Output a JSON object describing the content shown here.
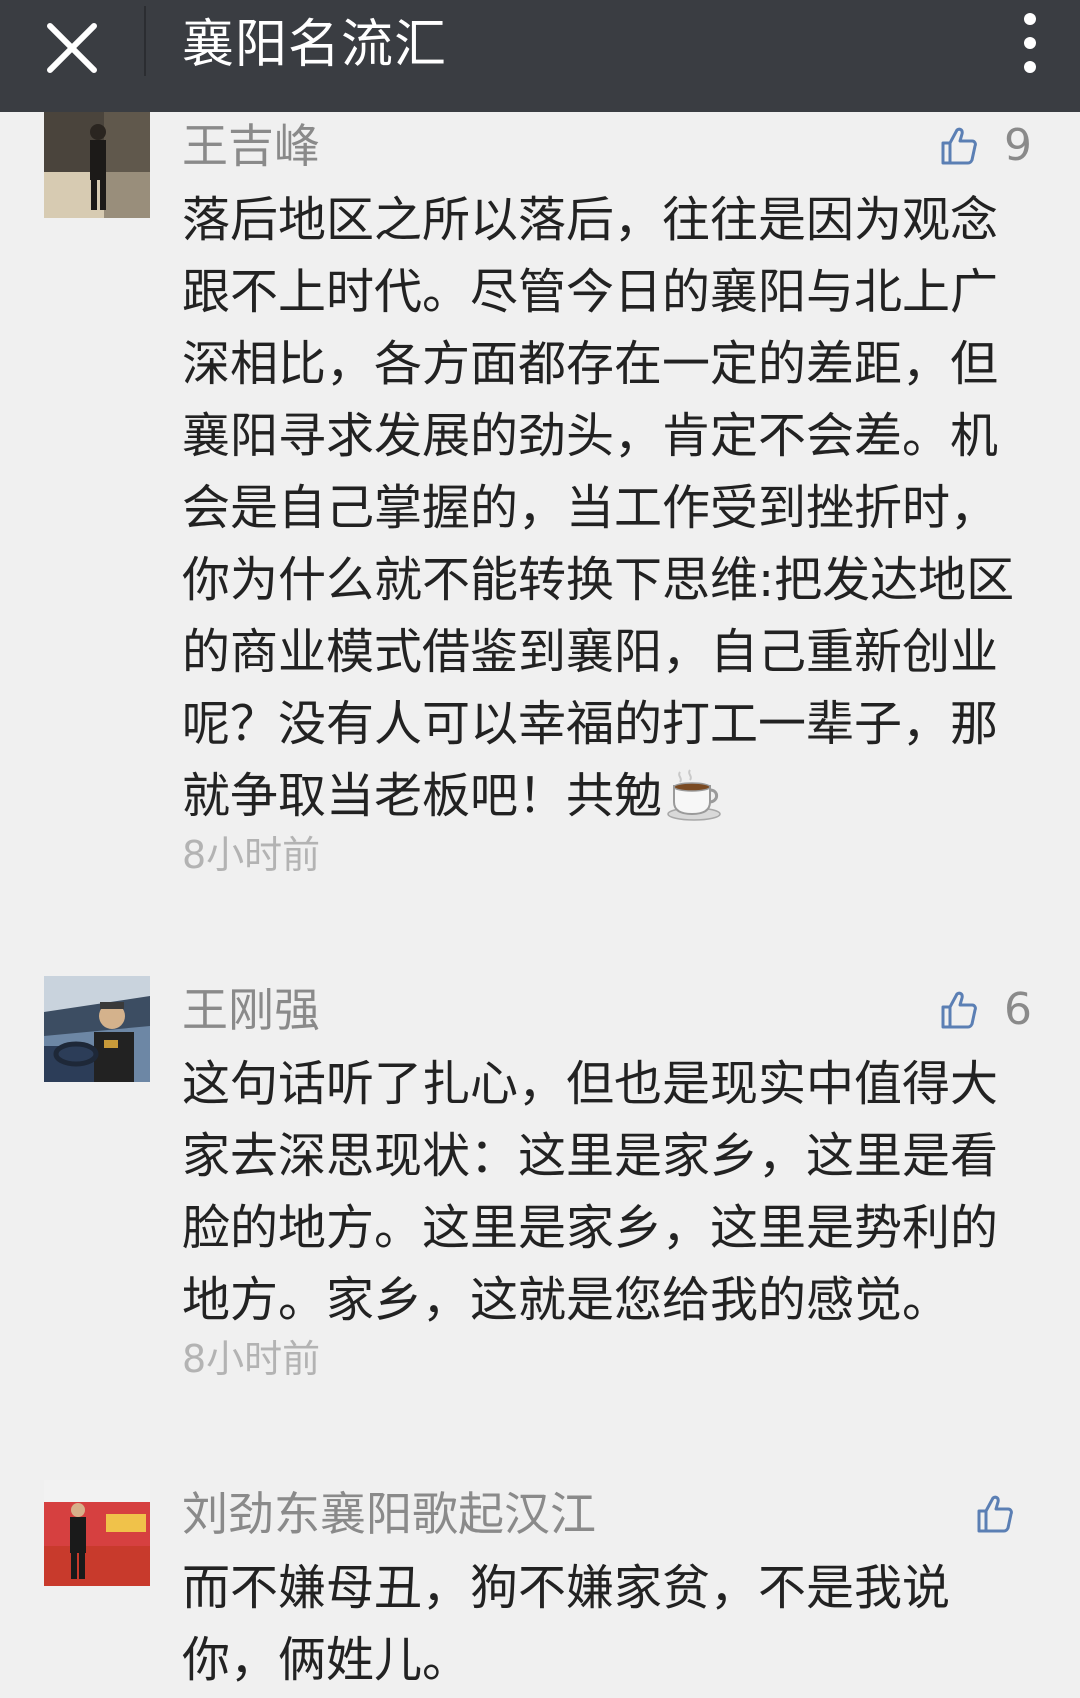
{
  "header": {
    "title": "襄阳名流汇",
    "close_icon": "close-icon",
    "more_icon": "more-vertical-icon",
    "background": "#3a3d42"
  },
  "comments": [
    {
      "name": "王吉峰",
      "likes": "9",
      "text": "落后地区之所以落后，往往是因为观念跟不上时代。尽管今日的襄阳与北上广深相比，各方面都存在一定的差距，但襄阳寻求发展的劲头，肯定不会差。机会是自己掌握的，当工作受到挫折时，你为什么就不能转换下思维:把发达地区的商业模式借鉴到襄阳，自己重新创业呢？没有人可以幸福的打工一辈子，那就争取当老板吧！共勉",
      "emoji": "coffee-cup-icon",
      "time": "8小时前"
    },
    {
      "name": "王刚强",
      "likes": "6",
      "text": "这句话听了扎心，但也是现实中值得大家去深思现状：这里是家乡，这里是看脸的地方。这里是家乡，这里是势利的地方。家乡，这就是您给我的感觉。",
      "time": "8小时前"
    },
    {
      "name": "刘劲东襄阳歌起汉江",
      "likes": "",
      "text": "而不嫌母丑，狗不嫌家贫，不是我说你，俩姓儿。"
    }
  ],
  "colors": {
    "name": "#8a8a8a",
    "text": "#222222",
    "time": "#b3b3b3",
    "thumb": "#5b7fb4",
    "background": "#f0f0f0"
  }
}
